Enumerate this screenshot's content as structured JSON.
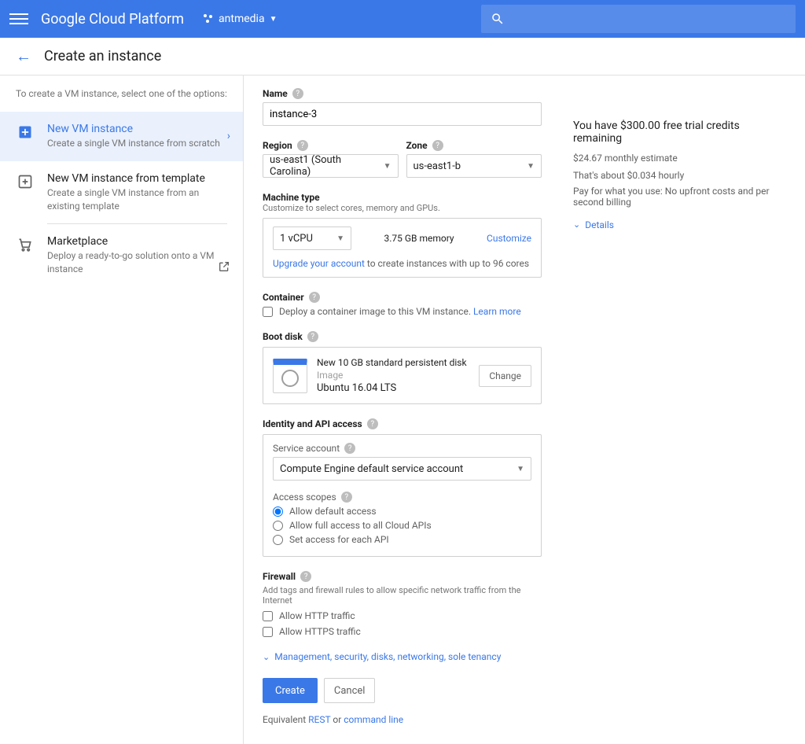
{
  "header": {
    "title": "Google Cloud Platform",
    "project": "antmedia"
  },
  "page": {
    "title": "Create an instance"
  },
  "sidebar": {
    "hint": "To create a VM instance, select one of the options:",
    "options": [
      {
        "title": "New VM instance",
        "desc": "Create a single VM instance from scratch"
      },
      {
        "title": "New VM instance from template",
        "desc": "Create a single VM instance from an existing template"
      },
      {
        "title": "Marketplace",
        "desc": "Deploy a ready-to-go solution onto a VM instance"
      }
    ]
  },
  "form": {
    "name_label": "Name",
    "name_value": "instance-3",
    "region_label": "Region",
    "region_value": "us-east1 (South Carolina)",
    "zone_label": "Zone",
    "zone_value": "us-east1-b",
    "machine_label": "Machine type",
    "machine_hint": "Customize to select cores, memory and GPUs.",
    "vcpu": "1 vCPU",
    "memory": "3.75 GB memory",
    "customize": "Customize",
    "upgrade_link": "Upgrade your account",
    "upgrade_rest": " to create instances with up to 96 cores",
    "container_label": "Container",
    "container_check": "Deploy a container image to this VM instance.",
    "learn_more": "Learn more",
    "bootdisk_label": "Boot disk",
    "bootdisk_line1": "New 10 GB standard persistent disk",
    "bootdisk_line2": "Image",
    "bootdisk_line3": "Ubuntu 16.04 LTS",
    "change": "Change",
    "identity_label": "Identity and API access",
    "service_account_label": "Service account",
    "service_account_value": "Compute Engine default service account",
    "access_scopes_label": "Access scopes",
    "scopes": [
      "Allow default access",
      "Allow full access to all Cloud APIs",
      "Set access for each API"
    ],
    "firewall_label": "Firewall",
    "firewall_hint": "Add tags and firewall rules to allow specific network traffic from the Internet",
    "firewall_http": "Allow HTTP traffic",
    "firewall_https": "Allow HTTPS traffic",
    "expand_text": "Management, security, disks, networking, sole tenancy",
    "create": "Create",
    "cancel": "Cancel",
    "equiv_pre": "Equivalent ",
    "equiv_rest": "REST",
    "equiv_or": " or ",
    "equiv_cmd": "command line"
  },
  "cost": {
    "credits": "You have $300.00 free trial credits remaining",
    "estimate": "$24.67 monthly estimate",
    "hourly": "That's about $0.034 hourly",
    "pay": "Pay for what you use: No upfront costs and per second billing",
    "details": "Details"
  }
}
